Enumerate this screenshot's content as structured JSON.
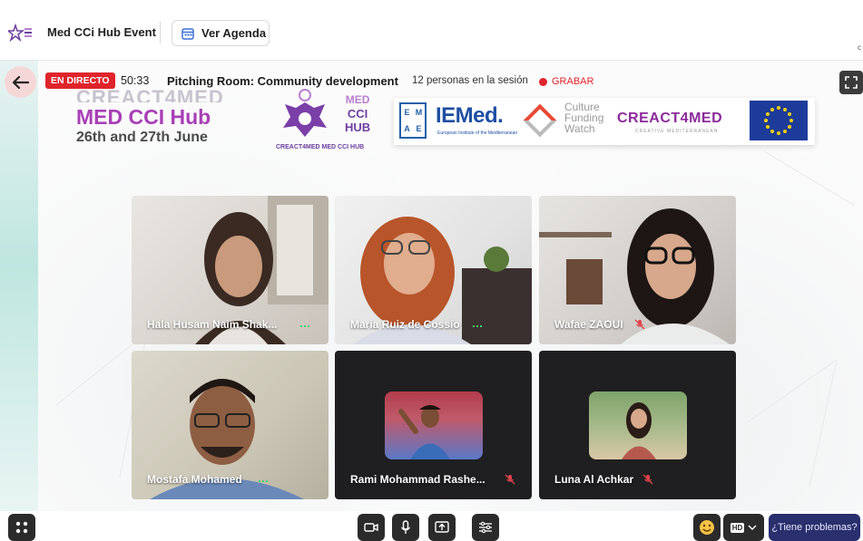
{
  "header": {
    "app_title": "Med CCi Hub Event",
    "agenda_label": "Ver Agenda",
    "edge_text": "c"
  },
  "session": {
    "live_label": "EN DIRECTO",
    "timer": "50:33",
    "room_title": "Pitching Room: Community development",
    "people_count": "12 personas en la sesión",
    "record_label": "GRABAR"
  },
  "banner": {
    "line1": "CREACT4MED",
    "line2": "MED CCI Hub",
    "line3": "26th and 27th June",
    "hub_text_med": "MED",
    "hub_text_cci": "CCI",
    "hub_text_hub": "HUB",
    "hub_caption": "CREACT4MED MED CCI HUB",
    "sponsors": {
      "emae": [
        "E",
        "M",
        "A",
        "E"
      ],
      "iemed": "IEMed.",
      "iemed_sub": "European Institute of the Mediterranean",
      "cfw": [
        "Culture",
        "Funding",
        "Watch"
      ],
      "creact": "CREACT4MED",
      "creact_sub": "CREATIVE MEDITERRANEAN"
    }
  },
  "participants": [
    {
      "name": "Hala Husam Naim Shak...",
      "audio": "speaking"
    },
    {
      "name": "Maria Ruiz de Cossío",
      "audio": "speaking"
    },
    {
      "name": "Wafae ZAOUI",
      "audio": "muted"
    },
    {
      "name": "Mostafa Mohamed",
      "audio": "speaking"
    },
    {
      "name": "Rami Mohammad Rashe...",
      "audio": "muted"
    },
    {
      "name": "Luna Al Achkar",
      "audio": "muted"
    }
  ],
  "controls": {
    "hd_label": "HD",
    "help_label": "¿Tiene problemas?"
  },
  "colors": {
    "live_red": "#e0242b",
    "brand_purple": "#a83fb6",
    "help_blue": "#2a2f6d",
    "speaking_green": "#3fd46b"
  }
}
